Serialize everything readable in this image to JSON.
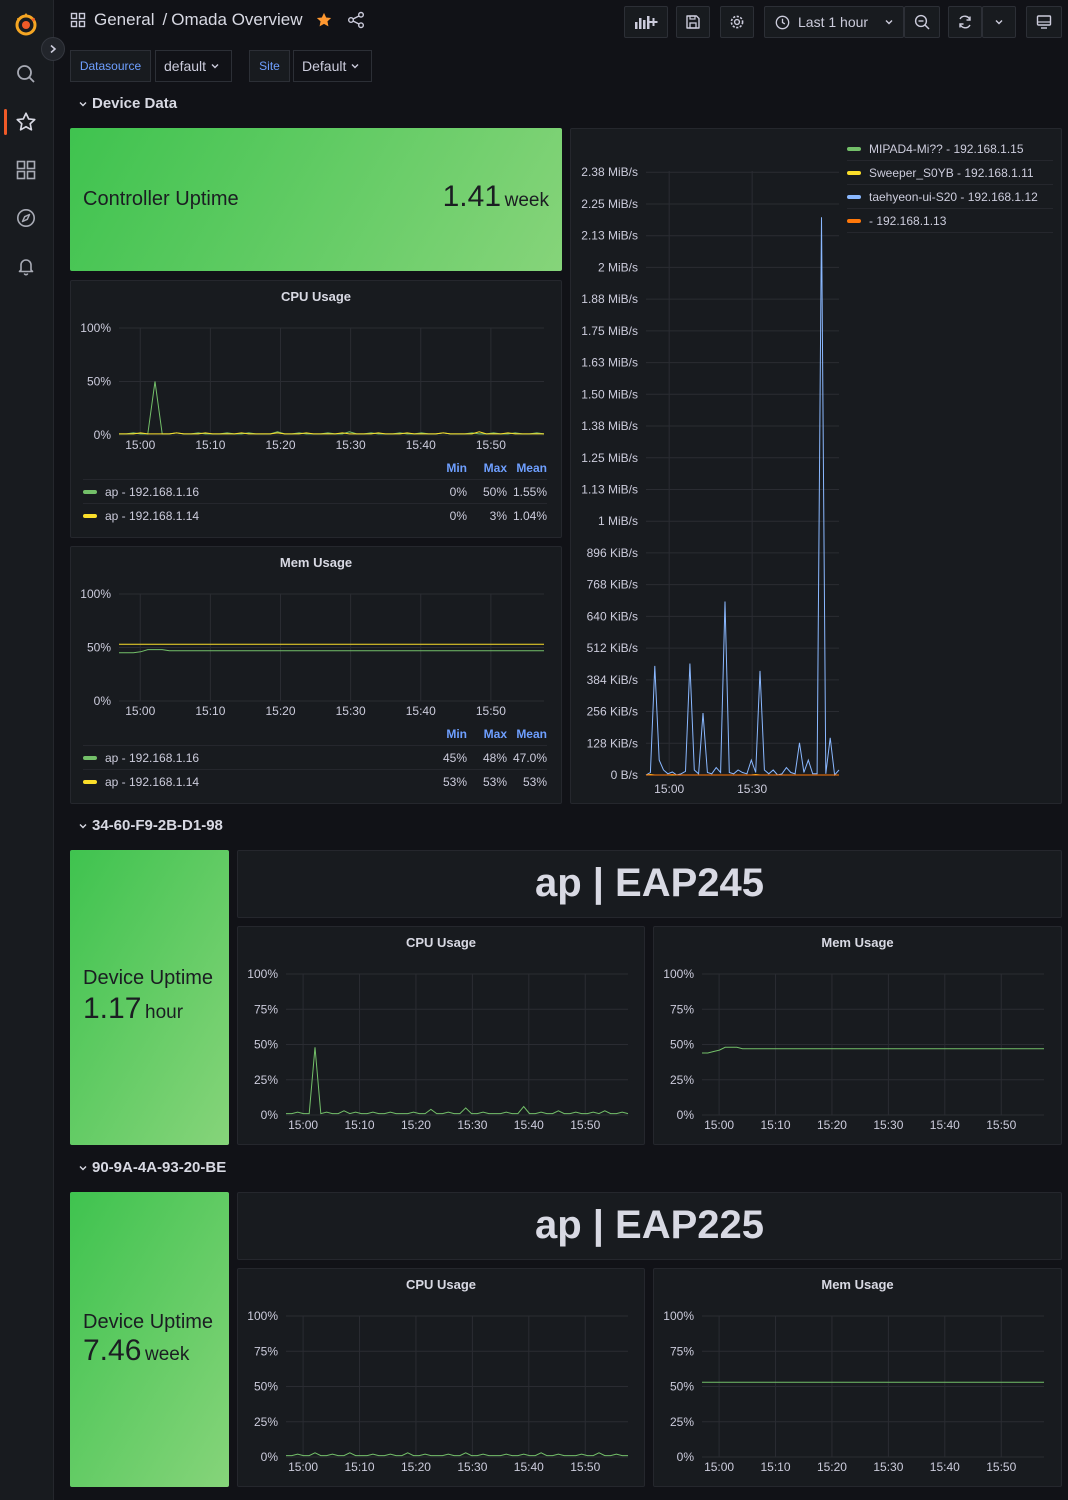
{
  "colors": {
    "green": "#73bf69",
    "yellow": "#fade2a",
    "blue": "#8ab8ff",
    "orange": "#ff780a"
  },
  "header": {
    "folder": "General",
    "separator": "/",
    "title": "Omada Overview",
    "time_range": "Last 1 hour"
  },
  "variables": [
    {
      "label": "Datasource",
      "value": "default"
    },
    {
      "label": "Site",
      "value": "Default"
    }
  ],
  "rows": {
    "device_data": "Device Data",
    "dev1": "34-60-F9-2B-D1-98",
    "dev2": "90-9A-4A-93-20-BE"
  },
  "controller_uptime": {
    "label": "Controller Uptime",
    "value": "1.41",
    "unit": "week"
  },
  "cpu_panel": {
    "title": "CPU Usage",
    "legend_headers": [
      "Min",
      "Max",
      "Mean"
    ],
    "legend": [
      {
        "name": "ap - 192.168.1.16",
        "min": "0%",
        "max": "50%",
        "mean": "1.55%"
      },
      {
        "name": "ap - 192.168.1.14",
        "min": "0%",
        "max": "3%",
        "mean": "1.04%"
      }
    ]
  },
  "mem_panel": {
    "title": "Mem Usage",
    "legend_headers": [
      "Min",
      "Max",
      "Mean"
    ],
    "legend": [
      {
        "name": "ap - 192.168.1.16",
        "min": "45%",
        "max": "48%",
        "mean": "47.0%"
      },
      {
        "name": "ap - 192.168.1.14",
        "min": "53%",
        "max": "53%",
        "mean": "53%"
      }
    ]
  },
  "traffic_panel": {
    "legend": [
      "MIPAD4-Mi?? - 192.168.1.15",
      "Sweeper_S0YB - 192.168.1.11",
      "taehyeon-ui-S20 - 192.168.1.12",
      "- 192.168.1.13"
    ]
  },
  "device1": {
    "title": "ap | EAP245",
    "uptime_label": "Device Uptime",
    "uptime_value": "1.17",
    "uptime_unit": "hour",
    "cpu_title": "CPU Usage",
    "mem_title": "Mem Usage"
  },
  "device2": {
    "title": "ap | EAP225",
    "uptime_label": "Device Uptime",
    "uptime_value": "7.46",
    "uptime_unit": "week",
    "cpu_title": "CPU Usage",
    "mem_title": "Mem Usage"
  },
  "chart_data": [
    {
      "id": "cpu_main",
      "type": "line",
      "title": "CPU Usage",
      "x_ticks": [
        "15:00",
        "15:10",
        "15:20",
        "15:30",
        "15:40",
        "15:50"
      ],
      "y_ticks": [
        "0%",
        "50%",
        "100%"
      ],
      "ylim": [
        0,
        100
      ],
      "series": [
        {
          "name": "ap - 192.168.1.16",
          "color": "#73bf69",
          "values": [
            1,
            1,
            2,
            1,
            1,
            50,
            1,
            1,
            2,
            1,
            1,
            2,
            1,
            1,
            1,
            2,
            1,
            1,
            2,
            1,
            1,
            1,
            3,
            1,
            1,
            2,
            1,
            1,
            1,
            2,
            1,
            1,
            3,
            1,
            1,
            2,
            1,
            1,
            1,
            2,
            1,
            1,
            2,
            1,
            1,
            2,
            1,
            1,
            1,
            2,
            1,
            1,
            2,
            1,
            1,
            2,
            1,
            1,
            2,
            1
          ]
        },
        {
          "name": "ap - 192.168.1.14",
          "color": "#fade2a",
          "values": [
            1,
            1,
            1,
            2,
            1,
            1,
            1,
            1,
            2,
            1,
            1,
            1,
            2,
            1,
            1,
            1,
            1,
            2,
            1,
            1,
            1,
            1,
            2,
            1,
            1,
            1,
            2,
            1,
            1,
            1,
            1,
            2,
            1,
            1,
            1,
            1,
            2,
            1,
            1,
            1,
            2,
            1,
            1,
            1,
            1,
            2,
            1,
            1,
            1,
            1,
            3,
            1,
            1,
            1,
            2,
            1,
            1,
            1,
            1,
            1
          ]
        }
      ]
    },
    {
      "id": "mem_main",
      "type": "line",
      "title": "Mem Usage",
      "x_ticks": [
        "15:00",
        "15:10",
        "15:20",
        "15:30",
        "15:40",
        "15:50"
      ],
      "y_ticks": [
        "0%",
        "50%",
        "100%"
      ],
      "ylim": [
        0,
        100
      ],
      "series": [
        {
          "name": "ap - 192.168.1.16",
          "color": "#73bf69",
          "values": [
            45,
            45,
            45,
            46,
            48,
            48,
            48,
            47,
            47,
            47,
            47,
            47,
            47,
            47,
            47,
            47,
            47,
            47,
            47,
            47,
            47,
            47,
            47,
            47,
            47,
            47,
            47,
            47,
            47,
            47,
            47,
            47,
            47,
            47,
            47,
            47,
            47,
            47,
            47,
            47,
            47,
            47,
            47,
            47,
            47,
            47,
            47,
            47,
            47,
            47,
            47,
            47,
            47,
            47,
            47,
            47,
            47,
            47,
            47,
            47
          ]
        },
        {
          "name": "ap - 192.168.1.14",
          "color": "#fade2a",
          "values": [
            53,
            53,
            53,
            53,
            53,
            53,
            53,
            53,
            53,
            53,
            53,
            53,
            53,
            53,
            53,
            53,
            53,
            53,
            53,
            53,
            53,
            53,
            53,
            53,
            53,
            53,
            53,
            53,
            53,
            53,
            53,
            53,
            53,
            53,
            53,
            53,
            53,
            53,
            53,
            53,
            53,
            53,
            53,
            53,
            53,
            53,
            53,
            53,
            53,
            53,
            53,
            53,
            53,
            53,
            53,
            53,
            53,
            53,
            53,
            53
          ]
        }
      ]
    },
    {
      "id": "traffic",
      "type": "line",
      "x_ticks": [
        "15:00",
        "15:30"
      ],
      "y_ticks": [
        "0 B/s",
        "128 KiB/s",
        "256 KiB/s",
        "384 KiB/s",
        "512 KiB/s",
        "640 KiB/s",
        "768 KiB/s",
        "896 KiB/s",
        "1 MiB/s",
        "1.13 MiB/s",
        "1.25 MiB/s",
        "1.38 MiB/s",
        "1.50 MiB/s",
        "1.63 MiB/s",
        "1.75 MiB/s",
        "1.88 MiB/s",
        "2 MiB/s",
        "2.13 MiB/s",
        "2.25 MiB/s",
        "2.38 MiB/s"
      ],
      "ylim_kib": [
        0,
        2437
      ],
      "series": [
        {
          "name": "taehyeon-ui-S20 - 192.168.1.12",
          "color": "#8ab8ff",
          "values_kib": [
            0,
            10,
            440,
            60,
            20,
            5,
            12,
            0,
            5,
            15,
            450,
            20,
            5,
            250,
            10,
            5,
            30,
            10,
            700,
            10,
            5,
            20,
            10,
            5,
            60,
            10,
            420,
            20,
            5,
            20,
            0,
            5,
            30,
            10,
            5,
            130,
            10,
            60,
            5,
            5,
            2250,
            5,
            150,
            0,
            20
          ]
        },
        {
          "name": "Sweeper_S0YB - 192.168.1.11",
          "color": "#fade2a",
          "values_kib": [
            0,
            2,
            0,
            0,
            0,
            0,
            0,
            0,
            0,
            0,
            0,
            0,
            0,
            0,
            0,
            0,
            0,
            0,
            0,
            0,
            0,
            0,
            0,
            0,
            0,
            2,
            0,
            0,
            0,
            0,
            0,
            0,
            0,
            0,
            0,
            0,
            0,
            0,
            0,
            0,
            0,
            0,
            0,
            0,
            0
          ]
        },
        {
          "name": "- 192.168.1.13",
          "color": "#ff780a",
          "values_kib": [
            0,
            0,
            0,
            0,
            0,
            0,
            2,
            0,
            0,
            0,
            0,
            0,
            0,
            0,
            0,
            0,
            0,
            0,
            0,
            0,
            0,
            0,
            0,
            0,
            0,
            0,
            0,
            0,
            0,
            0,
            0,
            0,
            0,
            0,
            0,
            0,
            0,
            0,
            0,
            0,
            0,
            0,
            0,
            0,
            0
          ]
        }
      ]
    },
    {
      "id": "dev1_cpu",
      "type": "line",
      "title": "CPU Usage",
      "x_ticks": [
        "15:00",
        "15:10",
        "15:20",
        "15:30",
        "15:40",
        "15:50"
      ],
      "y_ticks": [
        "0%",
        "25%",
        "50%",
        "75%",
        "100%"
      ],
      "ylim": [
        0,
        100
      ],
      "series": [
        {
          "name": "ap",
          "color": "#73bf69",
          "values": [
            1,
            1,
            2,
            1,
            1,
            48,
            1,
            2,
            1,
            1,
            3,
            1,
            2,
            1,
            1,
            2,
            1,
            1,
            2,
            1,
            1,
            1,
            2,
            1,
            1,
            4,
            1,
            1,
            2,
            1,
            1,
            5,
            1,
            1,
            2,
            1,
            1,
            1,
            2,
            1,
            1,
            6,
            1,
            1,
            2,
            1,
            1,
            3,
            1,
            1,
            2,
            1,
            1,
            2,
            1,
            3,
            1,
            1,
            2,
            1
          ]
        }
      ]
    },
    {
      "id": "dev1_mem",
      "type": "line",
      "title": "Mem Usage",
      "x_ticks": [
        "15:00",
        "15:10",
        "15:20",
        "15:30",
        "15:40",
        "15:50"
      ],
      "y_ticks": [
        "0%",
        "25%",
        "50%",
        "75%",
        "100%"
      ],
      "ylim": [
        0,
        100
      ],
      "series": [
        {
          "name": "ap",
          "color": "#73bf69",
          "values": [
            44,
            44,
            45,
            46,
            48,
            48,
            48,
            47,
            47,
            47,
            47,
            47,
            47,
            47,
            47,
            47,
            47,
            47,
            47,
            47,
            47,
            47,
            47,
            47,
            47,
            47,
            47,
            47,
            47,
            47,
            47,
            47,
            47,
            47,
            47,
            47,
            47,
            47,
            47,
            47,
            47,
            47,
            47,
            47,
            47,
            47,
            47,
            47,
            47,
            47,
            47,
            47,
            47,
            47,
            47,
            47,
            47,
            47,
            47,
            47
          ]
        }
      ]
    },
    {
      "id": "dev2_cpu",
      "type": "line",
      "title": "CPU Usage",
      "x_ticks": [
        "15:00",
        "15:10",
        "15:20",
        "15:30",
        "15:40",
        "15:50"
      ],
      "y_ticks": [
        "0%",
        "25%",
        "50%",
        "75%",
        "100%"
      ],
      "ylim": [
        0,
        100
      ],
      "series": [
        {
          "name": "ap",
          "color": "#73bf69",
          "values": [
            1,
            1,
            2,
            1,
            1,
            3,
            1,
            1,
            2,
            1,
            1,
            3,
            1,
            1,
            1,
            2,
            1,
            1,
            2,
            1,
            1,
            3,
            1,
            1,
            2,
            1,
            1,
            1,
            2,
            1,
            1,
            3,
            1,
            1,
            2,
            1,
            1,
            1,
            2,
            1,
            1,
            2,
            1,
            1,
            3,
            1,
            1,
            2,
            1,
            1,
            1,
            2,
            1,
            1,
            3,
            1,
            1,
            2,
            1,
            1
          ]
        }
      ]
    },
    {
      "id": "dev2_mem",
      "type": "line",
      "title": "Mem Usage",
      "x_ticks": [
        "15:00",
        "15:10",
        "15:20",
        "15:30",
        "15:40",
        "15:50"
      ],
      "y_ticks": [
        "0%",
        "25%",
        "50%",
        "75%",
        "100%"
      ],
      "ylim": [
        0,
        100
      ],
      "series": [
        {
          "name": "ap",
          "color": "#73bf69",
          "values": [
            53,
            53,
            53,
            53,
            53,
            53,
            53,
            53,
            53,
            53,
            53,
            53,
            53,
            53,
            53,
            53,
            53,
            53,
            53,
            53,
            53,
            53,
            53,
            53,
            53,
            53,
            53,
            53,
            53,
            53,
            53,
            53,
            53,
            53,
            53,
            53,
            53,
            53,
            53,
            53,
            53,
            53,
            53,
            53,
            53,
            53,
            53,
            53,
            53,
            53,
            53,
            53,
            53,
            53,
            53,
            53,
            53,
            53,
            53,
            53
          ]
        }
      ]
    }
  ]
}
